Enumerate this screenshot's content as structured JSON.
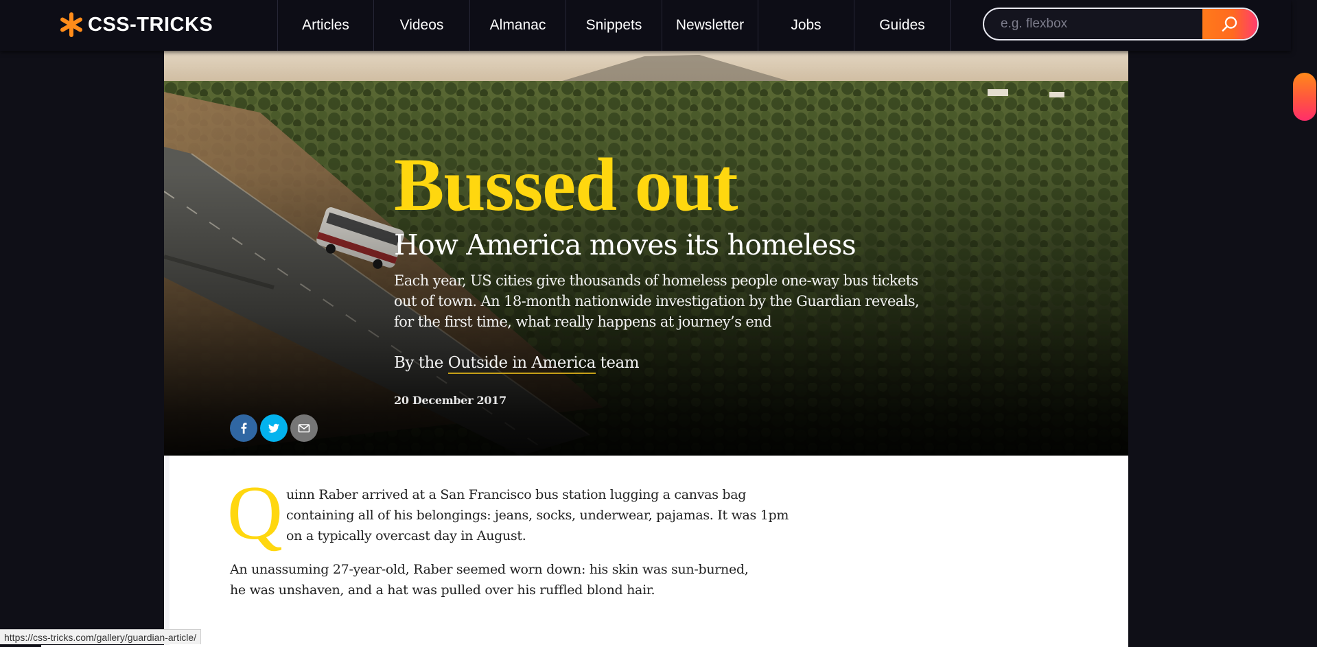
{
  "brand": {
    "name": "CSS-TRICKS"
  },
  "nav": {
    "items": [
      "Articles",
      "Videos",
      "Almanac",
      "Snippets",
      "Newsletter",
      "Jobs",
      "Guides"
    ]
  },
  "search": {
    "placeholder": "e.g. flexbox",
    "value": ""
  },
  "article": {
    "title": "Bussed out",
    "subtitle": "How America moves its homeless",
    "standfirst": "Each year, US cities give thousands of homeless people one-way bus tickets out of town. An 18-month nationwide investigation by the Guardian reveals, for the first time, what really happens at journey’s end",
    "byline": {
      "prefix": "By the ",
      "link": "Outside in America",
      "suffix": " team"
    },
    "date": "20 December 2017",
    "dropcap": "Q",
    "para1": "uinn Raber arrived at a San Francisco bus station lugging a canvas bag containing all of his belongings: jeans, socks, underwear, pajamas. It was 1pm on a typically overcast day in August.",
    "para2": "An unassuming 27-year-old, Raber seemed worn down: his skin was sun-burned, he was unshaven, and a hat was pulled over his ruffled blond hair."
  },
  "share": [
    "facebook-icon",
    "twitter-icon",
    "email-icon"
  ],
  "status": {
    "url": "https://css-tricks.com/gallery/guardian-article/"
  },
  "colors": {
    "header_bg": "#0d0d16",
    "accent_orange": "#ff7a1a",
    "accent_pink": "#ff3d6e",
    "headline_yellow": "#ffd70f",
    "facebook": "#3067a3",
    "twitter": "#03b3ee",
    "email": "#767676"
  }
}
